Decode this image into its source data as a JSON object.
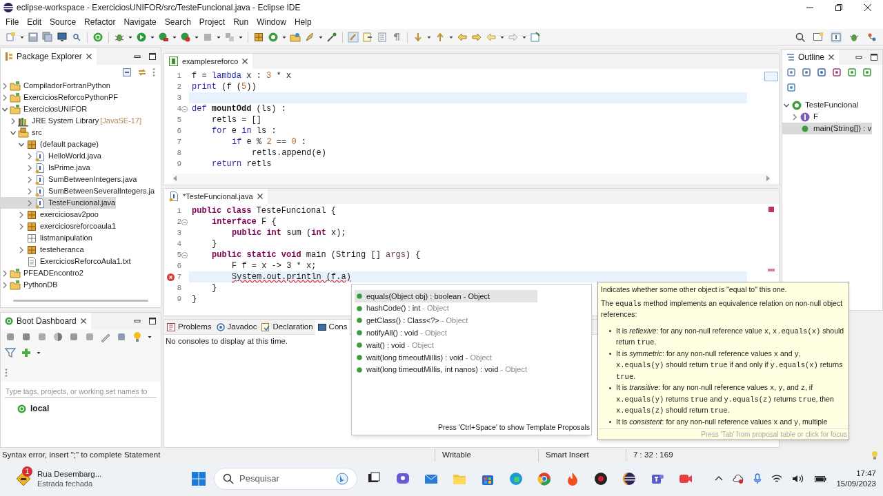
{
  "window": {
    "title": "eclipse-workspace - ExerciciosUNIFOR/src/TesteFuncional.java - Eclipse IDE"
  },
  "menu": [
    "File",
    "Edit",
    "Source",
    "Refactor",
    "Navigate",
    "Search",
    "Project",
    "Run",
    "Window",
    "Help"
  ],
  "package_explorer": {
    "title": "Package Explorer",
    "tree": [
      {
        "label": "CompiladorFortranPython",
        "kind": "project",
        "expanded": false,
        "selected": false
      },
      {
        "label": "ExerciciosReforcoPythonPF",
        "kind": "project",
        "expanded": false,
        "selected": false
      },
      {
        "label": "ExerciciosUNIFOR",
        "kind": "project",
        "expanded": true,
        "selected": false,
        "children": [
          {
            "label": "JRE System Library",
            "decoration": "[JavaSE-17]",
            "kind": "library",
            "expanded": false,
            "selected": false
          },
          {
            "label": "src",
            "kind": "source",
            "expanded": true,
            "selected": false,
            "children": [
              {
                "label": "(default package)",
                "kind": "package",
                "expanded": true,
                "selected": false,
                "children": [
                  {
                    "label": "HelloWorld.java",
                    "kind": "java",
                    "expanded": false,
                    "selected": false
                  },
                  {
                    "label": "IsPrime.java",
                    "kind": "java",
                    "expanded": false,
                    "selected": false
                  },
                  {
                    "label": "SumBetweenIntegers.java",
                    "kind": "java",
                    "expanded": false,
                    "selected": false
                  },
                  {
                    "label": "SumBetweenSeveralIntegers.ja",
                    "kind": "java",
                    "expanded": false,
                    "selected": false
                  },
                  {
                    "label": "TesteFuncional.java",
                    "kind": "java",
                    "expanded": false,
                    "selected": true
                  }
                ]
              },
              {
                "label": "exerciciosav2poo",
                "kind": "package",
                "expanded": false,
                "selected": false
              },
              {
                "label": "exerciciosreforcoaula1",
                "kind": "package",
                "expanded": false,
                "selected": false
              },
              {
                "label": "listmanipulation",
                "kind": "empty_package",
                "selected": false
              },
              {
                "label": "testeheranca",
                "kind": "package",
                "expanded": false,
                "selected": false
              },
              {
                "label": "ExerciciosReforcoAula1.txt",
                "kind": "text",
                "selected": false
              }
            ]
          }
        ]
      },
      {
        "label": "PFEADEncontro2",
        "kind": "project",
        "expanded": false,
        "selected": false
      },
      {
        "label": "PythonDB",
        "kind": "project",
        "expanded": false,
        "selected": false
      }
    ]
  },
  "editors": [
    {
      "tab": "examplesreforco",
      "kind": "python",
      "lines": [
        {
          "num": "1",
          "current": false,
          "fold": false,
          "segs": [
            {
              "kind": "plain",
              "text": "f = "
            },
            {
              "kind": "pykw",
              "text": "lambda"
            },
            {
              "kind": "plain",
              "text": " x : "
            },
            {
              "kind": "num",
              "text": "3"
            },
            {
              "kind": "plain",
              "text": " * x"
            }
          ]
        },
        {
          "num": "2",
          "current": false,
          "fold": false,
          "segs": [
            {
              "kind": "pykw",
              "text": "print"
            },
            {
              "kind": "plain",
              "text": " (f ("
            },
            {
              "kind": "num",
              "text": "5"
            },
            {
              "kind": "plain",
              "text": "))"
            }
          ]
        },
        {
          "num": "3",
          "current": true,
          "fold": false
        },
        {
          "num": "4",
          "current": false,
          "fold": true,
          "segs": [
            {
              "kind": "pykw",
              "text": "def"
            },
            {
              "kind": "fn",
              "text": " mountOdd"
            },
            {
              "kind": "plain",
              "text": " (ls) :"
            }
          ],
          "children": [
            {
              "num": "5",
              "current": false,
              "fold": false,
              "segs": [
                {
                  "kind": "plain",
                  "text": "retls = []"
                }
              ]
            },
            {
              "num": "6",
              "current": false,
              "fold": false,
              "segs": [
                {
                  "kind": "pykw",
                  "text": "for"
                },
                {
                  "kind": "plain",
                  "text": " e "
                },
                {
                  "kind": "pykw",
                  "text": "in"
                },
                {
                  "kind": "plain",
                  "text": " ls :"
                }
              ],
              "children": [
                {
                  "num": "7",
                  "current": false,
                  "fold": false,
                  "segs": [
                    {
                      "kind": "pykw",
                      "text": "if"
                    },
                    {
                      "kind": "plain",
                      "text": " e % "
                    },
                    {
                      "kind": "num",
                      "text": "2"
                    },
                    {
                      "kind": "plain",
                      "text": " == "
                    },
                    {
                      "kind": "num",
                      "text": "0"
                    },
                    {
                      "kind": "plain",
                      "text": " :"
                    }
                  ],
                  "children": [
                    {
                      "num": "8",
                      "current": false,
                      "fold": false,
                      "segs": [
                        {
                          "kind": "plain",
                          "text": "retls.append(e)"
                        }
                      ]
                    }
                  ]
                }
              ]
            },
            {
              "num": "9",
              "current": false,
              "fold": false,
              "segs": [
                {
                  "kind": "pykw",
                  "text": "return"
                },
                {
                  "kind": "plain",
                  "text": " retls"
                }
              ]
            }
          ]
        }
      ]
    },
    {
      "tab": "*TesteFuncional.java",
      "kind": "java",
      "lines": [
        {
          "num": "1",
          "current": false,
          "fold": false,
          "segs": [
            {
              "kind": "kw",
              "text": "public class"
            },
            {
              "kind": "plain",
              "text": " TesteFuncional {"
            }
          ],
          "children": [
            {
              "num": "2",
              "current": false,
              "fold": true,
              "segs": [
                {
                  "kind": "kw",
                  "text": "interface"
                },
                {
                  "kind": "plain",
                  "text": " F {"
                }
              ],
              "children": [
                {
                  "num": "3",
                  "current": false,
                  "fold": false,
                  "segs": [
                    {
                      "kind": "kw",
                      "text": "public int"
                    },
                    {
                      "kind": "plain",
                      "text": " sum ("
                    },
                    {
                      "kind": "kw",
                      "text": "int"
                    },
                    {
                      "kind": "plain",
                      "text": " x);"
                    }
                  ]
                }
              ]
            },
            {
              "num": "4",
              "current": false,
              "fold": false,
              "segs": [
                {
                  "kind": "plain",
                  "text": "}"
                }
              ]
            },
            {
              "num": "5",
              "current": false,
              "fold": true,
              "segs": [
                {
                  "kind": "kw",
                  "text": "public static void"
                },
                {
                  "kind": "plain",
                  "text": " main (String [] "
                },
                {
                  "kind": "param",
                  "text": "args"
                },
                {
                  "kind": "plain",
                  "text": ") {"
                }
              ],
              "children": [
                {
                  "num": "6",
                  "current": false,
                  "fold": false,
                  "segs": [
                    {
                      "kind": "plain",
                      "text": "F f = x -> 3 * x;"
                    }
                  ]
                },
                {
                  "num": "7",
                  "current": true,
                  "fold": false,
                  "error": true,
                  "segs": [
                    {
                      "kind": "plain",
                      "text": "System.out.println (f.a)"
                    }
                  ]
                }
              ]
            },
            {
              "num": "8",
              "current": false,
              "fold": false,
              "segs": [
                {
                  "kind": "plain",
                  "text": "}"
                }
              ]
            }
          ]
        },
        {
          "num": "9",
          "current": false,
          "fold": false,
          "segs": [
            {
              "kind": "plain",
              "text": "}"
            }
          ]
        }
      ]
    }
  ],
  "completion": {
    "items": [
      {
        "signature": "equals(Object obj) : boolean",
        "owner": "- Object",
        "selected": true
      },
      {
        "signature": "hashCode() : int",
        "owner": "- Object",
        "selected": false
      },
      {
        "signature": "getClass() : Class<?>",
        "owner": "- Object",
        "selected": false
      },
      {
        "signature": "notifyAll() : void",
        "owner": "- Object",
        "selected": false
      },
      {
        "signature": "wait() : void",
        "owner": "- Object",
        "selected": false
      },
      {
        "signature": "wait(long timeoutMillis) : void",
        "owner": "- Object",
        "selected": false
      },
      {
        "signature": "wait(long timeoutMillis, int nanos) : void",
        "owner": "- Object",
        "selected": false
      }
    ],
    "footer": "Press 'Ctrl+Space' to show Template Proposals"
  },
  "javadoc": {
    "paragraphs": [
      [
        {
          "kind": "t",
          "text": "Indicates whether some other object is \"equal to\" this one."
        }
      ],
      [
        {
          "kind": "t",
          "text": "The "
        },
        {
          "kind": "c",
          "text": "equals"
        },
        {
          "kind": "t",
          "text": " method implements an equivalence relation on non-null object references:"
        }
      ]
    ],
    "bullets": [
      [
        {
          "kind": "t",
          "text": "It is "
        },
        {
          "kind": "i",
          "text": "reflexive"
        },
        {
          "kind": "t",
          "text": ": for any non-null reference value "
        },
        {
          "kind": "c",
          "text": "x"
        },
        {
          "kind": "t",
          "text": ", "
        },
        {
          "kind": "c",
          "text": "x.equals(x)"
        },
        {
          "kind": "t",
          "text": " should return "
        },
        {
          "kind": "c",
          "text": "true"
        },
        {
          "kind": "t",
          "text": "."
        }
      ],
      [
        {
          "kind": "t",
          "text": "It is "
        },
        {
          "kind": "i",
          "text": "symmetric"
        },
        {
          "kind": "t",
          "text": ": for any non-null reference values "
        },
        {
          "kind": "c",
          "text": "x"
        },
        {
          "kind": "t",
          "text": " and "
        },
        {
          "kind": "c",
          "text": "y"
        },
        {
          "kind": "t",
          "text": ", "
        },
        {
          "kind": "c",
          "text": "x.equals(y)"
        },
        {
          "kind": "t",
          "text": " should return "
        },
        {
          "kind": "c",
          "text": "true"
        },
        {
          "kind": "t",
          "text": " if and only if "
        },
        {
          "kind": "c",
          "text": "y.equals(x)"
        },
        {
          "kind": "t",
          "text": " returns "
        },
        {
          "kind": "c",
          "text": "true"
        },
        {
          "kind": "t",
          "text": "."
        }
      ],
      [
        {
          "kind": "t",
          "text": "It is "
        },
        {
          "kind": "i",
          "text": "transitive"
        },
        {
          "kind": "t",
          "text": ": for any non-null reference values "
        },
        {
          "kind": "c",
          "text": "x"
        },
        {
          "kind": "t",
          "text": ", "
        },
        {
          "kind": "c",
          "text": "y"
        },
        {
          "kind": "t",
          "text": ", and "
        },
        {
          "kind": "c",
          "text": "z"
        },
        {
          "kind": "t",
          "text": ", if "
        },
        {
          "kind": "c",
          "text": "x.equals(y)"
        },
        {
          "kind": "t",
          "text": " returns "
        },
        {
          "kind": "c",
          "text": "true"
        },
        {
          "kind": "t",
          "text": " and "
        },
        {
          "kind": "c",
          "text": "y.equals(z)"
        },
        {
          "kind": "t",
          "text": " returns "
        },
        {
          "kind": "c",
          "text": "true"
        },
        {
          "kind": "t",
          "text": ", then "
        },
        {
          "kind": "c",
          "text": "x.equals(z)"
        },
        {
          "kind": "t",
          "text": " should return "
        },
        {
          "kind": "c",
          "text": "true"
        },
        {
          "kind": "t",
          "text": "."
        }
      ],
      [
        {
          "kind": "t",
          "text": "It is "
        },
        {
          "kind": "i",
          "text": "consistent"
        },
        {
          "kind": "t",
          "text": ": for any non-null reference values "
        },
        {
          "kind": "c",
          "text": "x"
        },
        {
          "kind": "t",
          "text": " and "
        },
        {
          "kind": "c",
          "text": "y"
        },
        {
          "kind": "t",
          "text": ", multiple"
        }
      ]
    ],
    "footer": "Press 'Tab' from proposal table or click for focus"
  },
  "outline": {
    "title": "Outline",
    "tree": [
      {
        "label": "TesteFuncional",
        "kind": "class",
        "expanded": true,
        "selected": false,
        "children": [
          {
            "label": "F",
            "kind": "interface",
            "expanded": false,
            "selected": false
          },
          {
            "label": "main(String[]) : v",
            "kind": "method",
            "selected": true
          }
        ]
      }
    ]
  },
  "boot_dashboard": {
    "title": "Boot Dashboard",
    "filter": {
      "placeholder": "Type tags, projects, or working set names to"
    },
    "items": [
      "local"
    ]
  },
  "bottom_panel": {
    "tabs": [
      {
        "label": "Problems",
        "kind": "problems",
        "selected": false
      },
      {
        "label": "Javadoc",
        "kind": "javadoc",
        "selected": false
      },
      {
        "label": "Declaration",
        "kind": "declaration",
        "selected": false
      },
      {
        "label": "Cons",
        "kind": "console",
        "selected": true
      }
    ],
    "message": "No consoles to display at this time."
  },
  "status_bar": {
    "message": "Syntax error, insert \";\" to complete Statement",
    "mode": "Writable",
    "insert": "Smart Insert",
    "position": "7 : 32 : 169"
  },
  "taskbar": {
    "weather": {
      "title": "Rua Desembarg...",
      "subtitle": "Estrada fechada",
      "badge": "1"
    },
    "search": {
      "placeholder": "Pesquisar"
    },
    "time": "17:47",
    "date": "15/09/2023"
  }
}
